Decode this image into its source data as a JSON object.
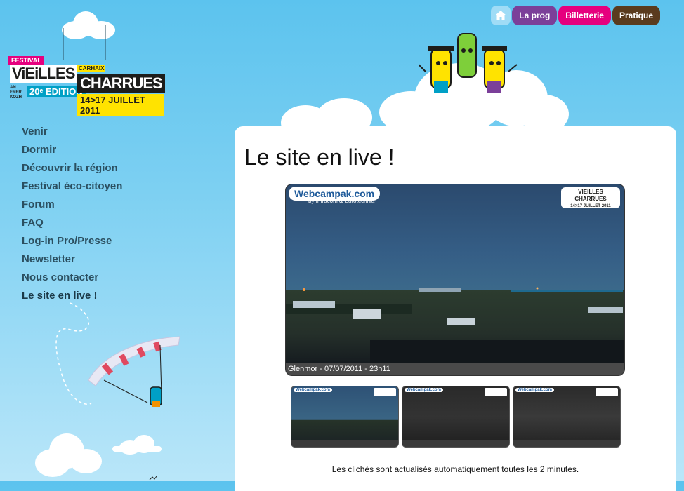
{
  "logo": {
    "festival": "FESTIVAL",
    "vieilles": "ViEiLLES",
    "carhaix": "CARHAIX",
    "edition": "20ᵉ EDITION",
    "charrues": "CHARRUES",
    "dates": "14>17 JUILLET 2011",
    "aber": "AN ERER KOZH"
  },
  "topnav": {
    "items": [
      {
        "label": "La prog",
        "color": "#7b3f99"
      },
      {
        "label": "Billetterie",
        "color": "#e6007e"
      },
      {
        "label": "Pratique",
        "color": "#5a3b1e"
      }
    ]
  },
  "menu": {
    "items": [
      {
        "label": "Venir"
      },
      {
        "label": "Dormir"
      },
      {
        "label": "Découvrir la région"
      },
      {
        "label": "Festival éco-citoyen"
      },
      {
        "label": "Forum"
      },
      {
        "label": "FAQ"
      },
      {
        "label": "Log-in Pro/Presse"
      },
      {
        "label": "Newsletter"
      },
      {
        "label": "Nous contacter"
      },
      {
        "label": "Le site en live !"
      }
    ]
  },
  "main": {
    "title": "Le site en live !",
    "webcam": {
      "logo": "Webcampak.com",
      "sublogo": "by Infracom  & Eurotechnia",
      "badge_line1": "VIEILLES",
      "badge_line2": "CHARRUES",
      "badge_line3": "14>17 JUILLET 2011",
      "caption": "Glenmor - 07/07/2011 - 23h11"
    },
    "thumbnails": [
      {
        "label": "Webcampak.com"
      },
      {
        "label": "Webcampak.com"
      },
      {
        "label": "Webcampak.com"
      }
    ],
    "note": "Les clichés sont actualisés automatiquement toutes les 2 minutes."
  }
}
